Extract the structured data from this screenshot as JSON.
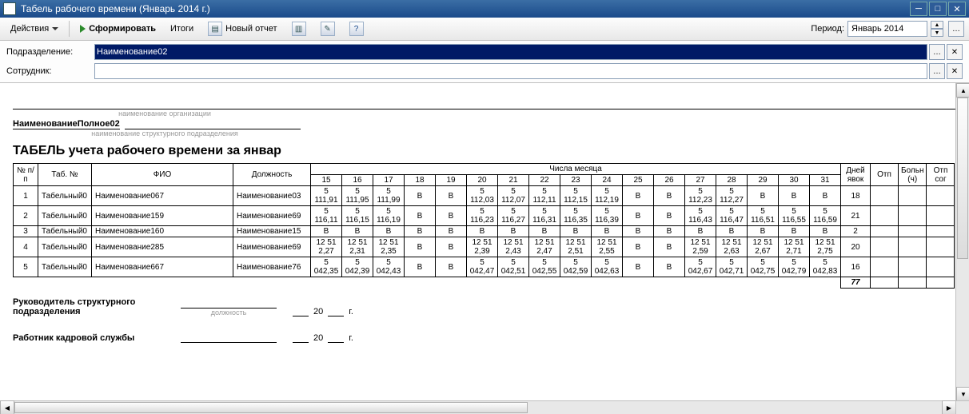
{
  "window": {
    "title": "Табель рабочего времени (Январь 2014 г.)"
  },
  "toolbar": {
    "actions": "Действия",
    "form": "Сформировать",
    "totals": "Итоги",
    "newreport": "Новый отчет",
    "period_label": "Период:",
    "period_value": "Январь 2014"
  },
  "filter": {
    "dept_label": "Подразделение:",
    "dept_value": "Наименование02",
    "emp_label": "Сотрудник:",
    "emp_value": ""
  },
  "doc": {
    "org_caption": "наименование организации",
    "subdiv_full": "НаименованиеПолное02",
    "subdiv_caption": "наименование структурного подразделения",
    "title": "ТАБЕЛЬ учета рабочего времени за январ",
    "headers": {
      "num": "№ п/п",
      "tabno": "Таб. №",
      "fio": "ФИО",
      "pos": "Должность",
      "days_of_month": "Числа месяца",
      "daynums": [
        "15",
        "16",
        "17",
        "18",
        "19",
        "20",
        "21",
        "22",
        "23",
        "24",
        "25",
        "26",
        "27",
        "28",
        "29",
        "30",
        "31"
      ],
      "days_appear": "Дней явок",
      "ext": [
        "Отп",
        "Больн (ч)",
        "Отп сог"
      ]
    },
    "rows": [
      {
        "n": "1",
        "tab": "Табельный0",
        "fio": "Наименование067",
        "pos": "Наименование03",
        "cells": [
          "5 111,91",
          "5 111,95",
          "5 111,99",
          "В",
          "В",
          "5 112,03",
          "5 112,07",
          "5 112,11",
          "5 112,15",
          "5 112,19",
          "В",
          "В",
          "5 112,23",
          "5 112,27",
          "В",
          "В",
          "В"
        ],
        "days": "18"
      },
      {
        "n": "2",
        "tab": "Табельный0",
        "fio": "Наименование159",
        "pos": "Наименование69",
        "cells": [
          "5 116,11",
          "5 116,15",
          "5 116,19",
          "В",
          "В",
          "5 116,23",
          "5 116,27",
          "5 116,31",
          "5 116,35",
          "5 116,39",
          "В",
          "В",
          "5 116,43",
          "5 116,47",
          "5 116,51",
          "5 116,55",
          "5 116,59"
        ],
        "days": "21"
      },
      {
        "n": "3",
        "tab": "Табельный0",
        "fio": "Наименование160",
        "pos": "Наименование15",
        "cells": [
          "В",
          "В",
          "В",
          "В",
          "В",
          "В",
          "В",
          "В",
          "В",
          "В",
          "В",
          "В",
          "В",
          "В",
          "В",
          "В",
          "В"
        ],
        "days": "2"
      },
      {
        "n": "4",
        "tab": "Табельный0",
        "fio": "Наименование285",
        "pos": "Наименование69",
        "cells": [
          "12 51 2,27",
          "12 51 2,31",
          "12 51 2,35",
          "В",
          "В",
          "12 51 2,39",
          "12 51 2,43",
          "12 51 2,47",
          "12 51 2,51",
          "12 51 2,55",
          "В",
          "В",
          "12 51 2,59",
          "12 51 2,63",
          "12 51 2,67",
          "12 51 2,71",
          "12 51 2,75"
        ],
        "days": "20"
      },
      {
        "n": "5",
        "tab": "Табельный0",
        "fio": "Наименование667",
        "pos": "Наименование76",
        "cells": [
          "5 042,35",
          "5 042,39",
          "5 042,43",
          "В",
          "В",
          "5 042,47",
          "5 042,51",
          "5 042,55",
          "5 042,59",
          "5 042,63",
          "В",
          "В",
          "5 042,67",
          "5 042,71",
          "5 042,75",
          "5 042,79",
          "5 042,83"
        ],
        "days": "16"
      }
    ],
    "total_days": "77",
    "sign": {
      "head": "Руководитель структурного подразделения",
      "hr": "Работник кадровой службы",
      "post_caption": "должность",
      "year_prefix": "20",
      "year_suffix": "г."
    }
  }
}
